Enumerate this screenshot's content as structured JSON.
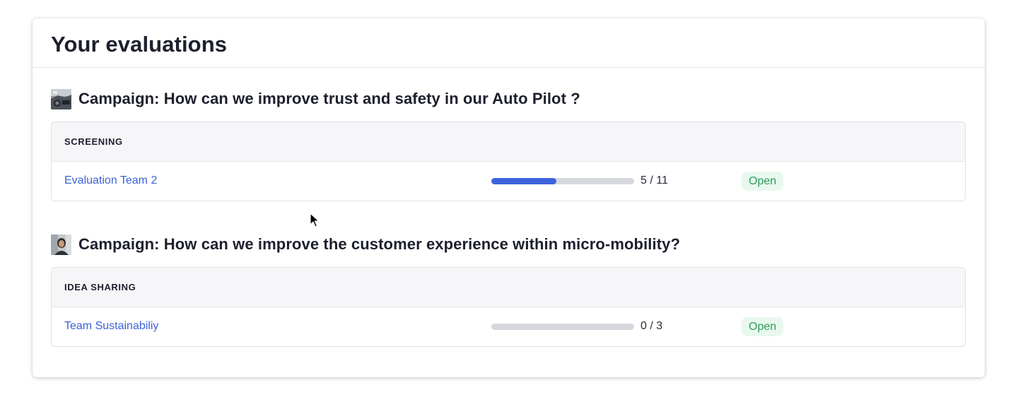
{
  "page": {
    "title": "Your evaluations"
  },
  "campaigns": [
    {
      "title": "Campaign: How can we improve trust and safety in our Auto Pilot ?",
      "thumbnail_icon": "car-interior-photo-icon",
      "phase": {
        "label": "SCREENING",
        "rows": [
          {
            "team": "Evaluation Team 2",
            "progress_done": 5,
            "progress_total": 11,
            "progress_text": "5 / 11",
            "status": "Open"
          }
        ]
      }
    },
    {
      "title": "Campaign: How can we improve the customer experience within micro-mobility?",
      "thumbnail_icon": "person-photo-icon",
      "phase": {
        "label": "IDEA SHARING",
        "rows": [
          {
            "team": "Team Sustainabiliy",
            "progress_done": 0,
            "progress_total": 3,
            "progress_text": "0 / 3",
            "status": "Open"
          }
        ]
      }
    }
  ],
  "colors": {
    "link": "#3b62d8",
    "progress_fill": "#3d63dd",
    "progress_track": "#d6d8de",
    "status_text": "#2f9b58",
    "status_bg": "#e8f8ee"
  }
}
